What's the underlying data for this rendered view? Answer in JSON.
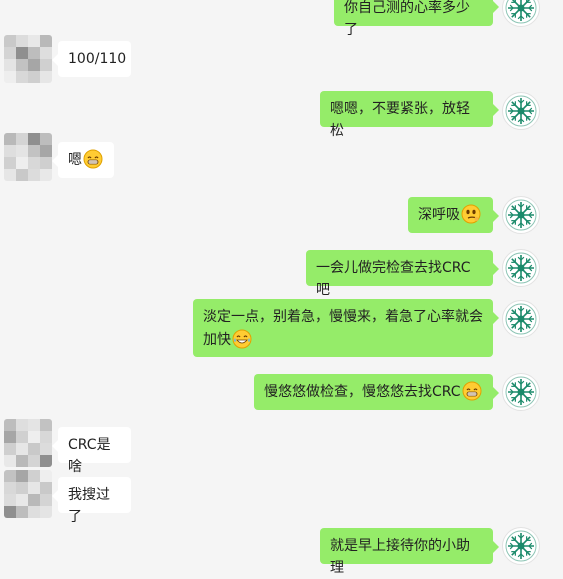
{
  "messages": [
    {
      "side": "me",
      "text": "你自己测的心率多少了",
      "emoji": null
    },
    {
      "side": "them",
      "text": "100/110",
      "emoji": null
    },
    {
      "side": "me",
      "text": "嗯嗯，不要紧张，放轻松",
      "emoji": null
    },
    {
      "side": "them",
      "text": "嗯",
      "emoji": "grin-emoji"
    },
    {
      "side": "me",
      "text": "深呼吸",
      "emoji": "smug-emoji"
    },
    {
      "side": "me",
      "text": "一会儿做完检查去找CRC吧",
      "emoji": null
    },
    {
      "side": "me",
      "text": "淡定一点，别着急，慢慢来，着急了心率就会加快",
      "emoji": "tears-of-joy-emoji"
    },
    {
      "side": "me",
      "text": "慢悠悠做检查，慢悠悠去找CRC",
      "emoji": "grin-emoji"
    },
    {
      "side": "them",
      "text": "CRC是啥",
      "emoji": null
    },
    {
      "side": "them",
      "text": "我搜过了",
      "emoji": null
    },
    {
      "side": "me",
      "text": "就是早上接待你的小助理",
      "emoji": null
    }
  ],
  "avatars": {
    "contact": "blurred-avatar",
    "self": "snowflake-avatar"
  },
  "colors": {
    "background": "#f5f5f5",
    "sent_bubble": "#95ec69",
    "received_bubble": "#ffffff",
    "self_avatar_accent": "#1a8a6a"
  }
}
